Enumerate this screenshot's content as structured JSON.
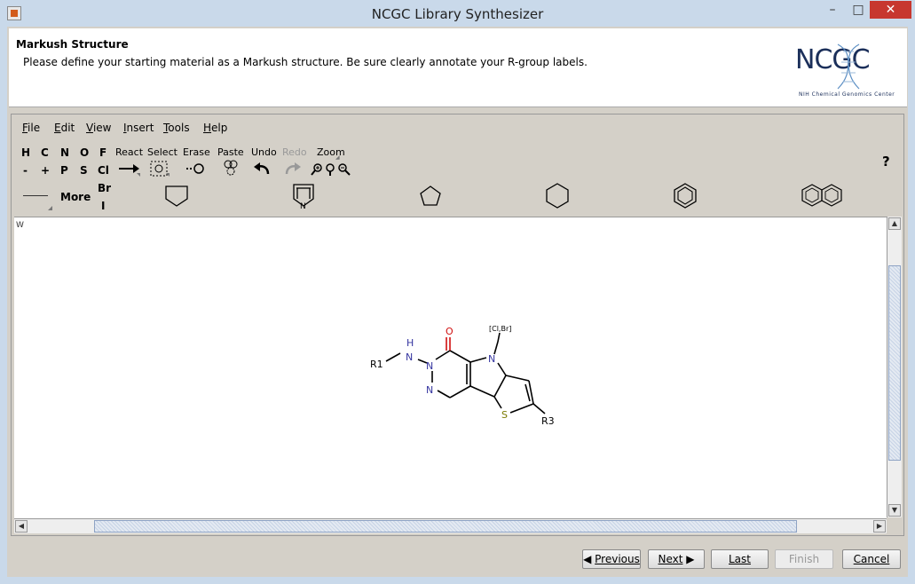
{
  "window": {
    "title": "NCGC Library Synthesizer",
    "minimize": "–",
    "maximize": "□",
    "close": "✕"
  },
  "header": {
    "title": "Markush Structure",
    "description": "Please define your starting material as a Markush structure. Be sure clearly annotate your R-group labels.",
    "logo_text": "NCGC",
    "logo_subtitle": "NIH Chemical Genomics Center"
  },
  "menu": [
    "File",
    "Edit",
    "View",
    "Insert",
    "Tools",
    "Help"
  ],
  "toolbar": {
    "atoms_row1": [
      "H",
      "C",
      "N",
      "O",
      "F"
    ],
    "atoms_row2": [
      "-",
      "+",
      "P",
      "S",
      "Cl"
    ],
    "atoms_row3": [
      "Br",
      "I"
    ],
    "more": "More",
    "react": "React",
    "select": "Select",
    "erase": "Erase",
    "paste": "Paste",
    "undo": "Undo",
    "redo": "Redo",
    "zoom": "Zoom",
    "help": "?"
  },
  "canvas": {
    "corner_label": "W",
    "molecule": {
      "r1": "R1",
      "nh_h": "H",
      "nh_n": "N",
      "n_ring": "N",
      "n_ring2": "N",
      "o": "O",
      "n_pyrrole": "N",
      "s": "S",
      "r3": "R3",
      "substituent": "[Cl,Br]"
    }
  },
  "buttons": {
    "previous": "Previous",
    "next": "Next",
    "last": "Last",
    "finish": "Finish",
    "cancel": "Cancel"
  },
  "colors": {
    "titlebar": "#c9d9ea",
    "close": "#c7372f",
    "nitrogen": "#3535a0",
    "oxygen": "#d01010",
    "sulfur": "#7a7a00"
  }
}
